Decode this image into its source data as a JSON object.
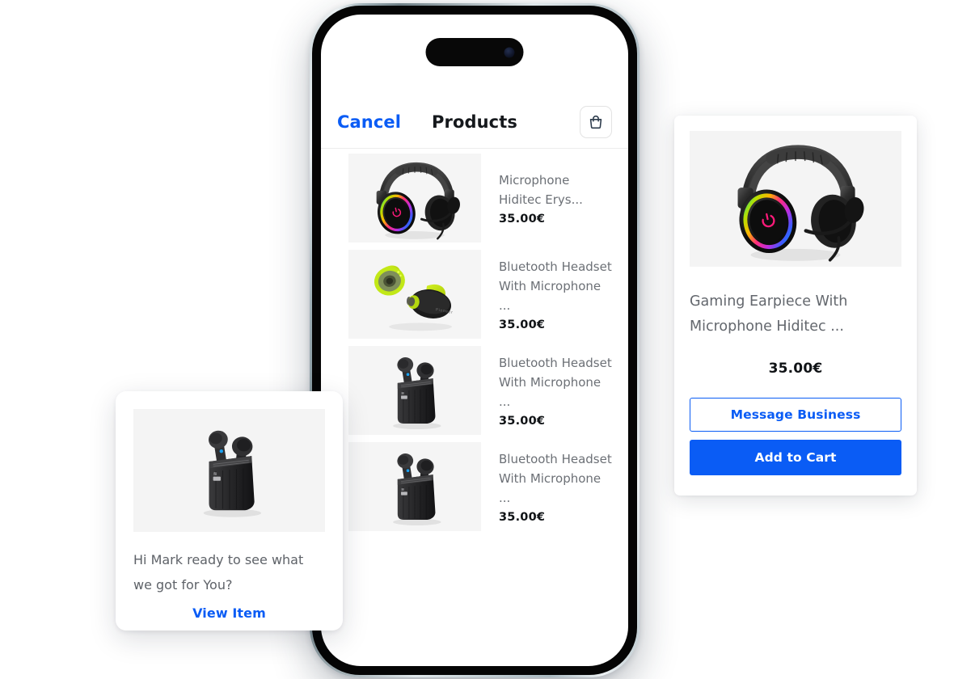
{
  "phone": {
    "notch": "dynamic-island",
    "nav": {
      "cancel_label": "Cancel",
      "title": "Products",
      "bag_icon": "shopping-bag-icon"
    },
    "products": [
      {
        "image": "gaming-headset-rgb",
        "name": "Microphone Hiditec Erys...",
        "price": "35.00€"
      },
      {
        "image": "green-wireless-earbuds",
        "name": "Bluetooth Headset With Microphone ...",
        "price": "35.00€"
      },
      {
        "image": "black-earbuds-case",
        "name": "Bluetooth Headset With Microphone ...",
        "price": "35.00€"
      },
      {
        "image": "black-earbuds-case",
        "name": "Bluetooth Headset With Microphone ...",
        "price": "35.00€"
      }
    ]
  },
  "detail_card": {
    "image": "gaming-headset-rgb",
    "name": "Gaming Earpiece With Microphone Hiditec ...",
    "price": "35.00€",
    "message_button_label": "Message Business",
    "add_to_cart_label": "Add to Cart"
  },
  "notification_card": {
    "image": "black-earbuds-case",
    "message": "Hi Mark ready to see what we got for You?",
    "link_label": "View Item"
  },
  "colors": {
    "accent_blue": "#0a5cf5",
    "title_dark": "#15181c",
    "body_gray": "#6c7076",
    "thumb_bg": "#f5f5f5",
    "bag_icon": "#2c3a4b"
  }
}
